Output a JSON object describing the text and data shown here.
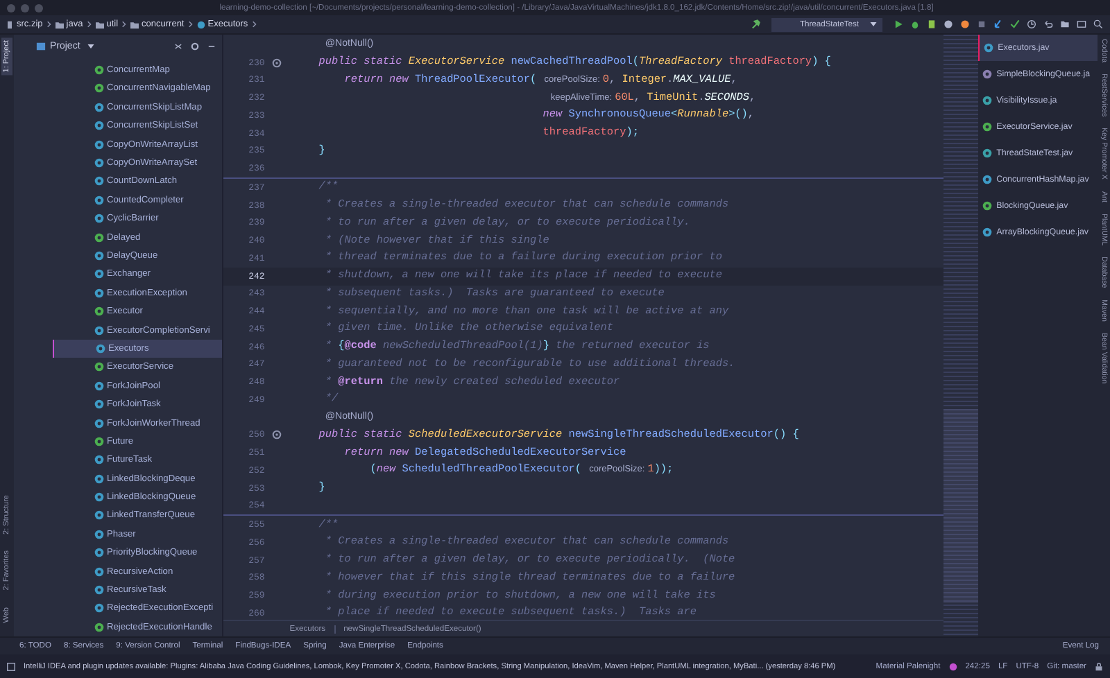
{
  "window": {
    "title": "learning-demo-collection [~/Documents/projects/personal/learning-demo-collection] - /Library/Java/JavaVirtualMachines/jdk1.8.0_162.jdk/Contents/Home/src.zip!/java/util/concurrent/Executors.java [1.8]"
  },
  "navbar": {
    "breadcrumbs": [
      {
        "label": "src.zip",
        "kind": "archive"
      },
      {
        "label": "java",
        "kind": "folder"
      },
      {
        "label": "util",
        "kind": "package"
      },
      {
        "label": "concurrent",
        "kind": "folder"
      },
      {
        "label": "Executors",
        "kind": "class"
      }
    ],
    "run_config": "ThreadStateTest"
  },
  "left_stripe": {
    "top": [
      {
        "label": "1: Project",
        "selected": true
      }
    ],
    "bottom": [
      {
        "label": "2: Structure",
        "selected": false
      },
      {
        "label": "2: Favorites",
        "selected": false
      },
      {
        "label": "Web",
        "selected": false
      }
    ]
  },
  "project_panel": {
    "title": "Project",
    "items": [
      {
        "label": "ConcurrentMap",
        "kind": "interface",
        "selected": false
      },
      {
        "label": "ConcurrentNavigableMap",
        "kind": "interface",
        "selected": false
      },
      {
        "label": "ConcurrentSkipListMap",
        "kind": "class",
        "selected": false
      },
      {
        "label": "ConcurrentSkipListSet",
        "kind": "class",
        "selected": false
      },
      {
        "label": "CopyOnWriteArrayList",
        "kind": "class",
        "selected": false
      },
      {
        "label": "CopyOnWriteArraySet",
        "kind": "class",
        "selected": false
      },
      {
        "label": "CountDownLatch",
        "kind": "class",
        "selected": false
      },
      {
        "label": "CountedCompleter",
        "kind": "class",
        "selected": false
      },
      {
        "label": "CyclicBarrier",
        "kind": "class",
        "selected": false
      },
      {
        "label": "Delayed",
        "kind": "interface",
        "selected": false
      },
      {
        "label": "DelayQueue",
        "kind": "class",
        "selected": false
      },
      {
        "label": "Exchanger",
        "kind": "class",
        "selected": false
      },
      {
        "label": "ExecutionException",
        "kind": "class",
        "selected": false
      },
      {
        "label": "Executor",
        "kind": "interface",
        "selected": false
      },
      {
        "label": "ExecutorCompletionServi",
        "kind": "class",
        "selected": false
      },
      {
        "label": "Executors",
        "kind": "class",
        "selected": true
      },
      {
        "label": "ExecutorService",
        "kind": "interface",
        "selected": false
      },
      {
        "label": "ForkJoinPool",
        "kind": "class",
        "selected": false
      },
      {
        "label": "ForkJoinTask",
        "kind": "class",
        "selected": false
      },
      {
        "label": "ForkJoinWorkerThread",
        "kind": "class",
        "selected": false
      },
      {
        "label": "Future",
        "kind": "interface",
        "selected": false
      },
      {
        "label": "FutureTask",
        "kind": "class",
        "selected": false
      },
      {
        "label": "LinkedBlockingDeque",
        "kind": "class",
        "selected": false
      },
      {
        "label": "LinkedBlockingQueue",
        "kind": "class",
        "selected": false
      },
      {
        "label": "LinkedTransferQueue",
        "kind": "class",
        "selected": false
      },
      {
        "label": "Phaser",
        "kind": "class",
        "selected": false
      },
      {
        "label": "PriorityBlockingQueue",
        "kind": "class",
        "selected": false
      },
      {
        "label": "RecursiveAction",
        "kind": "class",
        "selected": false
      },
      {
        "label": "RecursiveTask",
        "kind": "class",
        "selected": false
      },
      {
        "label": "RejectedExecutionExcepti",
        "kind": "class",
        "selected": false
      },
      {
        "label": "RejectedExecutionHandle",
        "kind": "interface",
        "selected": false
      }
    ]
  },
  "editor": {
    "lines": [
      {
        "tokens": [
          {
            "kind": "ann",
            "text": " @NotNull()"
          }
        ]
      },
      {
        "number": "230",
        "marker": true,
        "tokens": [
          {
            "kind": "kw",
            "text": "public static "
          },
          {
            "kind": "type",
            "text": "ExecutorService "
          },
          {
            "kind": "fn",
            "text": "newCachedThreadPool"
          },
          {
            "kind": "punc",
            "text": "("
          },
          {
            "kind": "type",
            "text": "ThreadFactory "
          },
          {
            "kind": "param",
            "text": "threadFactory"
          },
          {
            "kind": "punc",
            "text": ") {"
          }
        ]
      },
      {
        "number": "231",
        "tokens": [
          {
            "kind": "kw",
            "text": "    return new "
          },
          {
            "kind": "fn",
            "text": "ThreadPoolExecutor"
          },
          {
            "kind": "punc",
            "text": "( "
          },
          {
            "kind": "hint",
            "text": "corePoolSize:"
          },
          {
            "kind": "num",
            "text": "0"
          },
          {
            "kind": "plain",
            "text": ", "
          },
          {
            "kind": "cls",
            "text": "Integer"
          },
          {
            "kind": "plain",
            "text": "."
          },
          {
            "kind": "const",
            "text": "MAX_VALUE"
          },
          {
            "kind": "plain",
            "text": ","
          }
        ]
      },
      {
        "number": "232",
        "tokens": [
          {
            "kind": "hint",
            "text": "                                    keepAliveTime:"
          },
          {
            "kind": "num",
            "text": "60L"
          },
          {
            "kind": "plain",
            "text": ", "
          },
          {
            "kind": "cls",
            "text": "TimeUnit"
          },
          {
            "kind": "plain",
            "text": "."
          },
          {
            "kind": "const",
            "text": "SECONDS"
          },
          {
            "kind": "plain",
            "text": ","
          }
        ]
      },
      {
        "number": "233",
        "tokens": [
          {
            "kind": "kw",
            "text": "                                   new "
          },
          {
            "kind": "fn",
            "text": "SynchronousQueue"
          },
          {
            "kind": "punc",
            "text": "<"
          },
          {
            "kind": "type",
            "text": "Runnable"
          },
          {
            "kind": "punc",
            "text": ">()"
          },
          {
            "kind": "plain",
            "text": ","
          }
        ]
      },
      {
        "number": "234",
        "tokens": [
          {
            "kind": "param",
            "text": "                                   threadFactory"
          },
          {
            "kind": "punc",
            "text": ");"
          }
        ]
      },
      {
        "number": "235",
        "tokens": [
          {
            "kind": "punc",
            "text": "}"
          }
        ]
      },
      {
        "number": "236"
      },
      {
        "number": "237",
        "separator": true,
        "tokens": [
          {
            "kind": "cmt",
            "text": "/**"
          }
        ]
      },
      {
        "number": "238",
        "tokens": [
          {
            "kind": "cmt",
            "text": " * Creates a single-threaded executor that can schedule commands"
          }
        ]
      },
      {
        "number": "239",
        "tokens": [
          {
            "kind": "cmt",
            "text": " * to run after a given delay, or to execute periodically."
          }
        ]
      },
      {
        "number": "240",
        "tokens": [
          {
            "kind": "cmt",
            "text": " * (Note however that if this single"
          }
        ]
      },
      {
        "number": "241",
        "tokens": [
          {
            "kind": "cmt",
            "text": " * thread terminates due to a failure during execution prior to"
          }
        ]
      },
      {
        "number": "242",
        "current": true,
        "tokens": [
          {
            "kind": "cmt",
            "text": " * shutdown, a new one will take its place if needed to execute"
          }
        ]
      },
      {
        "number": "243",
        "tokens": [
          {
            "kind": "cmt",
            "text": " * subsequent tasks.)  Tasks are guaranteed to execute"
          }
        ]
      },
      {
        "number": "244",
        "tokens": [
          {
            "kind": "cmt",
            "text": " * sequentially, and no more than one task will be active at any"
          }
        ]
      },
      {
        "number": "245",
        "tokens": [
          {
            "kind": "cmt",
            "text": " * given time. Unlike the otherwise equivalent"
          }
        ]
      },
      {
        "number": "246",
        "tokens": [
          {
            "kind": "cmt",
            "text": " * "
          },
          {
            "kind": "punc",
            "text": "{"
          },
          {
            "kind": "tag",
            "text": "@code"
          },
          {
            "kind": "cmt",
            "text": " newScheduledThreadPool(1)"
          },
          {
            "kind": "punc",
            "text": "}"
          },
          {
            "kind": "cmt",
            "text": " the returned executor is"
          }
        ]
      },
      {
        "number": "247",
        "tokens": [
          {
            "kind": "cmt",
            "text": " * guaranteed not to be reconfigurable to use additional threads."
          }
        ]
      },
      {
        "number": "248",
        "tokens": [
          {
            "kind": "cmt",
            "text": " * "
          },
          {
            "kind": "tag",
            "text": "@return"
          },
          {
            "kind": "cmt",
            "text": " the newly created scheduled executor"
          }
        ]
      },
      {
        "number": "249",
        "tokens": [
          {
            "kind": "cmt",
            "text": " */"
          }
        ]
      },
      {
        "tokens": [
          {
            "kind": "ann",
            "text": " @NotNull()"
          }
        ]
      },
      {
        "number": "250",
        "marker": true,
        "tokens": [
          {
            "kind": "kw",
            "text": "public static "
          },
          {
            "kind": "type",
            "text": "ScheduledExecutorService "
          },
          {
            "kind": "fn",
            "text": "newSingleThreadScheduledExecutor"
          },
          {
            "kind": "punc",
            "text": "() {"
          }
        ]
      },
      {
        "number": "251",
        "tokens": [
          {
            "kind": "kw",
            "text": "    return new "
          },
          {
            "kind": "fn",
            "text": "DelegatedScheduledExecutorService"
          }
        ]
      },
      {
        "number": "252",
        "tokens": [
          {
            "kind": "punc",
            "text": "        ("
          },
          {
            "kind": "kw",
            "text": "new "
          },
          {
            "kind": "fn",
            "text": "ScheduledThreadPoolExecutor"
          },
          {
            "kind": "punc",
            "text": "( "
          },
          {
            "kind": "hint",
            "text": "corePoolSize:"
          },
          {
            "kind": "num",
            "text": "1"
          },
          {
            "kind": "punc",
            "text": "));"
          }
        ]
      },
      {
        "number": "253",
        "tokens": [
          {
            "kind": "punc",
            "text": "}"
          }
        ]
      },
      {
        "number": "254"
      },
      {
        "number": "255",
        "separator": true,
        "tokens": [
          {
            "kind": "cmt",
            "text": "/**"
          }
        ]
      },
      {
        "number": "256",
        "tokens": [
          {
            "kind": "cmt",
            "text": " * Creates a single-threaded executor that can schedule commands"
          }
        ]
      },
      {
        "number": "257",
        "tokens": [
          {
            "kind": "cmt",
            "text": " * to run after a given delay, or to execute periodically.  (Note"
          }
        ]
      },
      {
        "number": "258",
        "tokens": [
          {
            "kind": "cmt",
            "text": " * however that if this single thread terminates due to a failure"
          }
        ]
      },
      {
        "number": "259",
        "tokens": [
          {
            "kind": "cmt",
            "text": " * during execution prior to shutdown, a new one will take its"
          }
        ]
      },
      {
        "number": "260",
        "tokens": [
          {
            "kind": "cmt",
            "text": " * place if needed to execute subsequent tasks.)  Tasks are"
          }
        ]
      }
    ],
    "breadcrumbs": [
      "Executors",
      "newSingleThreadScheduledExecutor()"
    ]
  },
  "recent_files": [
    {
      "label": "Executors.jav",
      "kind": "class",
      "selected": true
    },
    {
      "label": "SimpleBlockingQueue.ja",
      "kind": "test",
      "selected": false
    },
    {
      "label": "VisibilityIssue.ja",
      "kind": "runnable",
      "selected": false
    },
    {
      "label": "ExecutorService.jav",
      "kind": "interface",
      "selected": false
    },
    {
      "label": "ThreadStateTest.jav",
      "kind": "runnable",
      "selected": false
    },
    {
      "label": "ConcurrentHashMap.jav",
      "kind": "class",
      "selected": false
    },
    {
      "label": "BlockingQueue.jav",
      "kind": "interface",
      "selected": false
    },
    {
      "label": "ArrayBlockingQueue.jav",
      "kind": "class",
      "selected": false
    }
  ],
  "right_stripe": [
    {
      "label": "Codota"
    },
    {
      "label": "RestServices"
    },
    {
      "label": "Key Promoter X"
    },
    {
      "label": "Ant"
    },
    {
      "label": "PlantUML"
    },
    {
      "label": "Database"
    },
    {
      "label": "Maven"
    },
    {
      "label": "Bean Validation"
    }
  ],
  "tool_windows": [
    {
      "label": "6: TODO"
    },
    {
      "label": "8: Services"
    },
    {
      "label": "9: Version Control"
    },
    {
      "label": "Terminal"
    },
    {
      "label": "FindBugs-IDEA"
    },
    {
      "label": "Spring"
    },
    {
      "label": "Java Enterprise"
    },
    {
      "label": "Endpoints"
    }
  ],
  "event_log": "Event Log",
  "status_bar": {
    "message": "IntelliJ IDEA and plugin updates available: Plugins: Alibaba Java Coding Guidelines, Lombok, Key Promoter X, Codota, Rainbow Brackets, String Manipulation, IdeaVim, Maven Helper, PlantUML integration, MyBati... (yesterday 8:46 PM)",
    "theme": "Material Palenight",
    "position": "242:25",
    "line_separator": "LF",
    "encoding": "UTF-8",
    "branch": "Git: master"
  }
}
